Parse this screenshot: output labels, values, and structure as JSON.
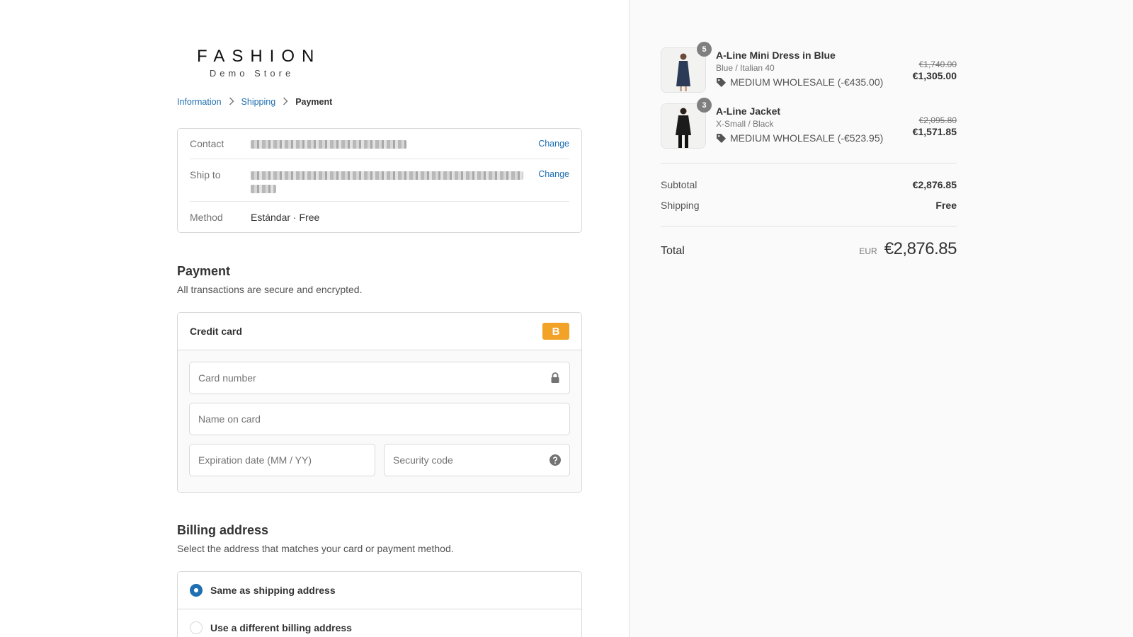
{
  "logo": {
    "main": "FASHION",
    "sub": "Demo Store"
  },
  "breadcrumb": {
    "step1": "Information",
    "step2": "Shipping",
    "step3": "Payment"
  },
  "review": {
    "contact_label": "Contact",
    "shipto_label": "Ship to",
    "method_label": "Method",
    "method_value": "Estándar · Free",
    "change_label": "Change"
  },
  "payment": {
    "title": "Payment",
    "subtitle": "All transactions are secure and encrypted.",
    "method_label": "Credit card",
    "badge_letter": "B",
    "card_number_placeholder": "Card number",
    "name_placeholder": "Name on card",
    "expiry_placeholder": "Expiration date (MM / YY)",
    "security_placeholder": "Security code"
  },
  "billing": {
    "title": "Billing address",
    "subtitle": "Select the address that matches your card or payment method.",
    "option_same": "Same as shipping address",
    "option_different": "Use a different billing address"
  },
  "cart": {
    "items": [
      {
        "name": "A-Line Mini Dress in Blue",
        "variant": "Blue / Italian 40",
        "discount": "MEDIUM WHOLESALE (-€435.00)",
        "price_old": "€1,740.00",
        "price_new": "€1,305.00",
        "quantity": "5"
      },
      {
        "name": "A-Line Jacket",
        "variant": "X-Small / Black",
        "discount": "MEDIUM WHOLESALE (-€523.95)",
        "price_old": "€2,095.80",
        "price_new": "€1,571.85",
        "quantity": "3"
      }
    ],
    "subtotal_label": "Subtotal",
    "subtotal_value": "€2,876.85",
    "shipping_label": "Shipping",
    "shipping_value": "Free",
    "total_label": "Total",
    "total_currency": "EUR",
    "total_value": "€2,876.85"
  },
  "colors": {
    "link": "#1f6fb2",
    "bitcoin": "#f2a227",
    "sidebar_bg": "#fafafa"
  },
  "icons": {
    "lock": "lock-icon",
    "help": "help-icon",
    "tag": "tag-icon",
    "chevron": "chevron-right-icon"
  }
}
